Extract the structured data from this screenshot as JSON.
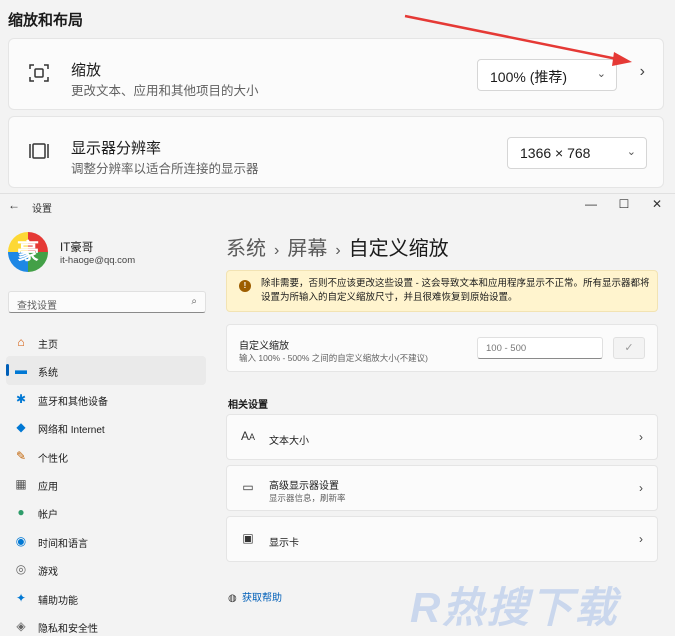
{
  "top": {
    "section_title": "缩放和布局",
    "scale_card": {
      "title": "缩放",
      "desc": "更改文本、应用和其他项目的大小",
      "value": "100% (推荐)"
    },
    "resolution_card": {
      "title": "显示器分辨率",
      "desc": "调整分辨率以适合所连接的显示器",
      "value": "1366 × 768"
    }
  },
  "window": {
    "back": "←",
    "title": "设置",
    "controls": [
      "—",
      "☐",
      "✕"
    ]
  },
  "profile": {
    "avatar_char": "豪",
    "name": "IT豪哥",
    "email": "it-haoge@qq.com"
  },
  "search": {
    "placeholder": "查找设置"
  },
  "nav": [
    {
      "label": "主页",
      "icon": "home-icon",
      "glyph": "⌂",
      "color": "#d35400"
    },
    {
      "label": "系统",
      "icon": "monitor-icon",
      "glyph": "▬",
      "color": "#0078d4",
      "active": true
    },
    {
      "label": "蓝牙和其他设备",
      "icon": "bluetooth-icon",
      "glyph": "✱",
      "color": "#0078d4"
    },
    {
      "label": "网络和 Internet",
      "icon": "wifi-icon",
      "glyph": "◆",
      "color": "#0078d4"
    },
    {
      "label": "个性化",
      "icon": "brush-icon",
      "glyph": "✎",
      "color": "#c06000"
    },
    {
      "label": "应用",
      "icon": "apps-icon",
      "glyph": "▦",
      "color": "#555555"
    },
    {
      "label": "帐户",
      "icon": "account-icon",
      "glyph": "●",
      "color": "#2e9c6a"
    },
    {
      "label": "时间和语言",
      "icon": "globe-icon",
      "glyph": "◉",
      "color": "#0078d4"
    },
    {
      "label": "游戏",
      "icon": "gamepad-icon",
      "glyph": "◎",
      "color": "#666666"
    },
    {
      "label": "辅助功能",
      "icon": "accessibility-icon",
      "glyph": "✦",
      "color": "#0078d4"
    },
    {
      "label": "隐私和安全性",
      "icon": "shield-icon",
      "glyph": "◈",
      "color": "#666666"
    }
  ],
  "breadcrumb": {
    "part1": "系统",
    "part2": "屏幕",
    "current": "自定义缩放",
    "sep": "›"
  },
  "warning": {
    "icon": "!",
    "text": "除非需要，否则不应该更改这些设置 - 这会导致文本和应用程序显示不正常。所有显示器都将设置为所输入的自定义缩放尺寸，并且很难恢复到原始设置。"
  },
  "custom_scale": {
    "title": "自定义缩放",
    "desc": "输入 100% - 500% 之间的自定义缩放大小(不建议)",
    "placeholder": "100 - 500",
    "confirm": "✓"
  },
  "related": {
    "heading": "相关设置",
    "items": [
      {
        "label": "文本大小",
        "sub": "",
        "glyph": "A",
        "icon": "text-size-icon"
      },
      {
        "label": "高级显示器设置",
        "sub": "显示器信息，刷新率",
        "glyph": "▭",
        "icon": "monitor-icon"
      },
      {
        "label": "显示卡",
        "sub": "",
        "glyph": "▣",
        "icon": "graphics-card-icon"
      }
    ]
  },
  "help": {
    "label": "获取帮助"
  },
  "watermark": "R热搜下载",
  "colors": {
    "accent": "#005fb8",
    "arrow": "#e53935",
    "warning_bg": "#fff4ce"
  }
}
